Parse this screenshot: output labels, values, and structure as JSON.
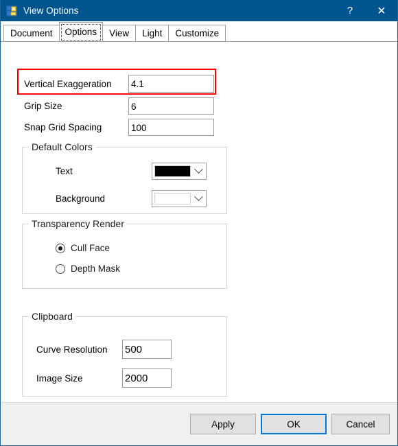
{
  "window": {
    "title": "View Options",
    "icon": "windows-form-icon",
    "titlebar_color": "#00558f",
    "buttons": [
      {
        "name": "help-button",
        "glyph": "?"
      },
      {
        "name": "close-button",
        "glyph": "✕"
      }
    ]
  },
  "tabs": [
    {
      "label": "Document",
      "selected": false
    },
    {
      "label": "Options",
      "selected": true
    },
    {
      "label": "View",
      "selected": false
    },
    {
      "label": "Light",
      "selected": false
    },
    {
      "label": "Customize",
      "selected": false
    }
  ],
  "options_page": {
    "fields": [
      {
        "label": "Vertical Exaggeration",
        "value": "4.1",
        "highlighted": true
      },
      {
        "label": "Grip Size",
        "value": "6",
        "highlighted": false
      },
      {
        "label": "Snap Grid Spacing",
        "value": "100",
        "highlighted": false
      }
    ],
    "highlight_color": "#ff0000",
    "default_colors": {
      "title": "Default Colors",
      "rows": [
        {
          "label": "Text",
          "swatch": "#000000"
        },
        {
          "label": "Background",
          "swatch": "#ffffff"
        }
      ]
    },
    "transparency_render": {
      "title": "Transparency Render",
      "options": [
        {
          "label": "Cull Face",
          "checked": true
        },
        {
          "label": "Depth Mask",
          "checked": false
        }
      ]
    },
    "clipboard": {
      "title": "Clipboard",
      "fields": [
        {
          "label": "Curve Resolution",
          "value": "500"
        },
        {
          "label": "Image Size",
          "value": "2000"
        }
      ]
    }
  },
  "footer": {
    "apply_label": "Apply",
    "ok_label": "OK",
    "cancel_label": "Cancel",
    "default_button": "OK",
    "accent_color": "#0078d7"
  }
}
